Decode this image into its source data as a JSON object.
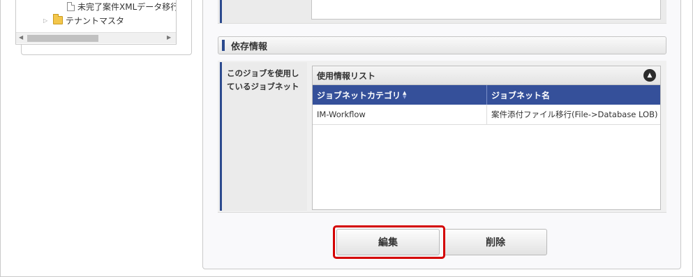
{
  "tree": {
    "items": [
      {
        "label": "未完了案件XMLデータ移行",
        "icon": "file-icon"
      },
      {
        "label": "テナントマスタ",
        "icon": "folder-icon"
      }
    ]
  },
  "dependency": {
    "section_title": "依存情報",
    "row_label_line1": "このジョブを使用し",
    "row_label_line2": "ているジョブネット",
    "grid": {
      "caption": "使用情報リスト",
      "columns": [
        "ジョブネットカテゴリ",
        "ジョブネット名"
      ],
      "rows": [
        [
          "IM-Workflow",
          "案件添付ファイル移行(File->Database LOB)"
        ]
      ]
    }
  },
  "buttons": {
    "edit": "編集",
    "delete": "削除"
  },
  "colors": {
    "accent": "#2c4a8e",
    "grid_header": "#35509a",
    "highlight": "#d40000"
  }
}
